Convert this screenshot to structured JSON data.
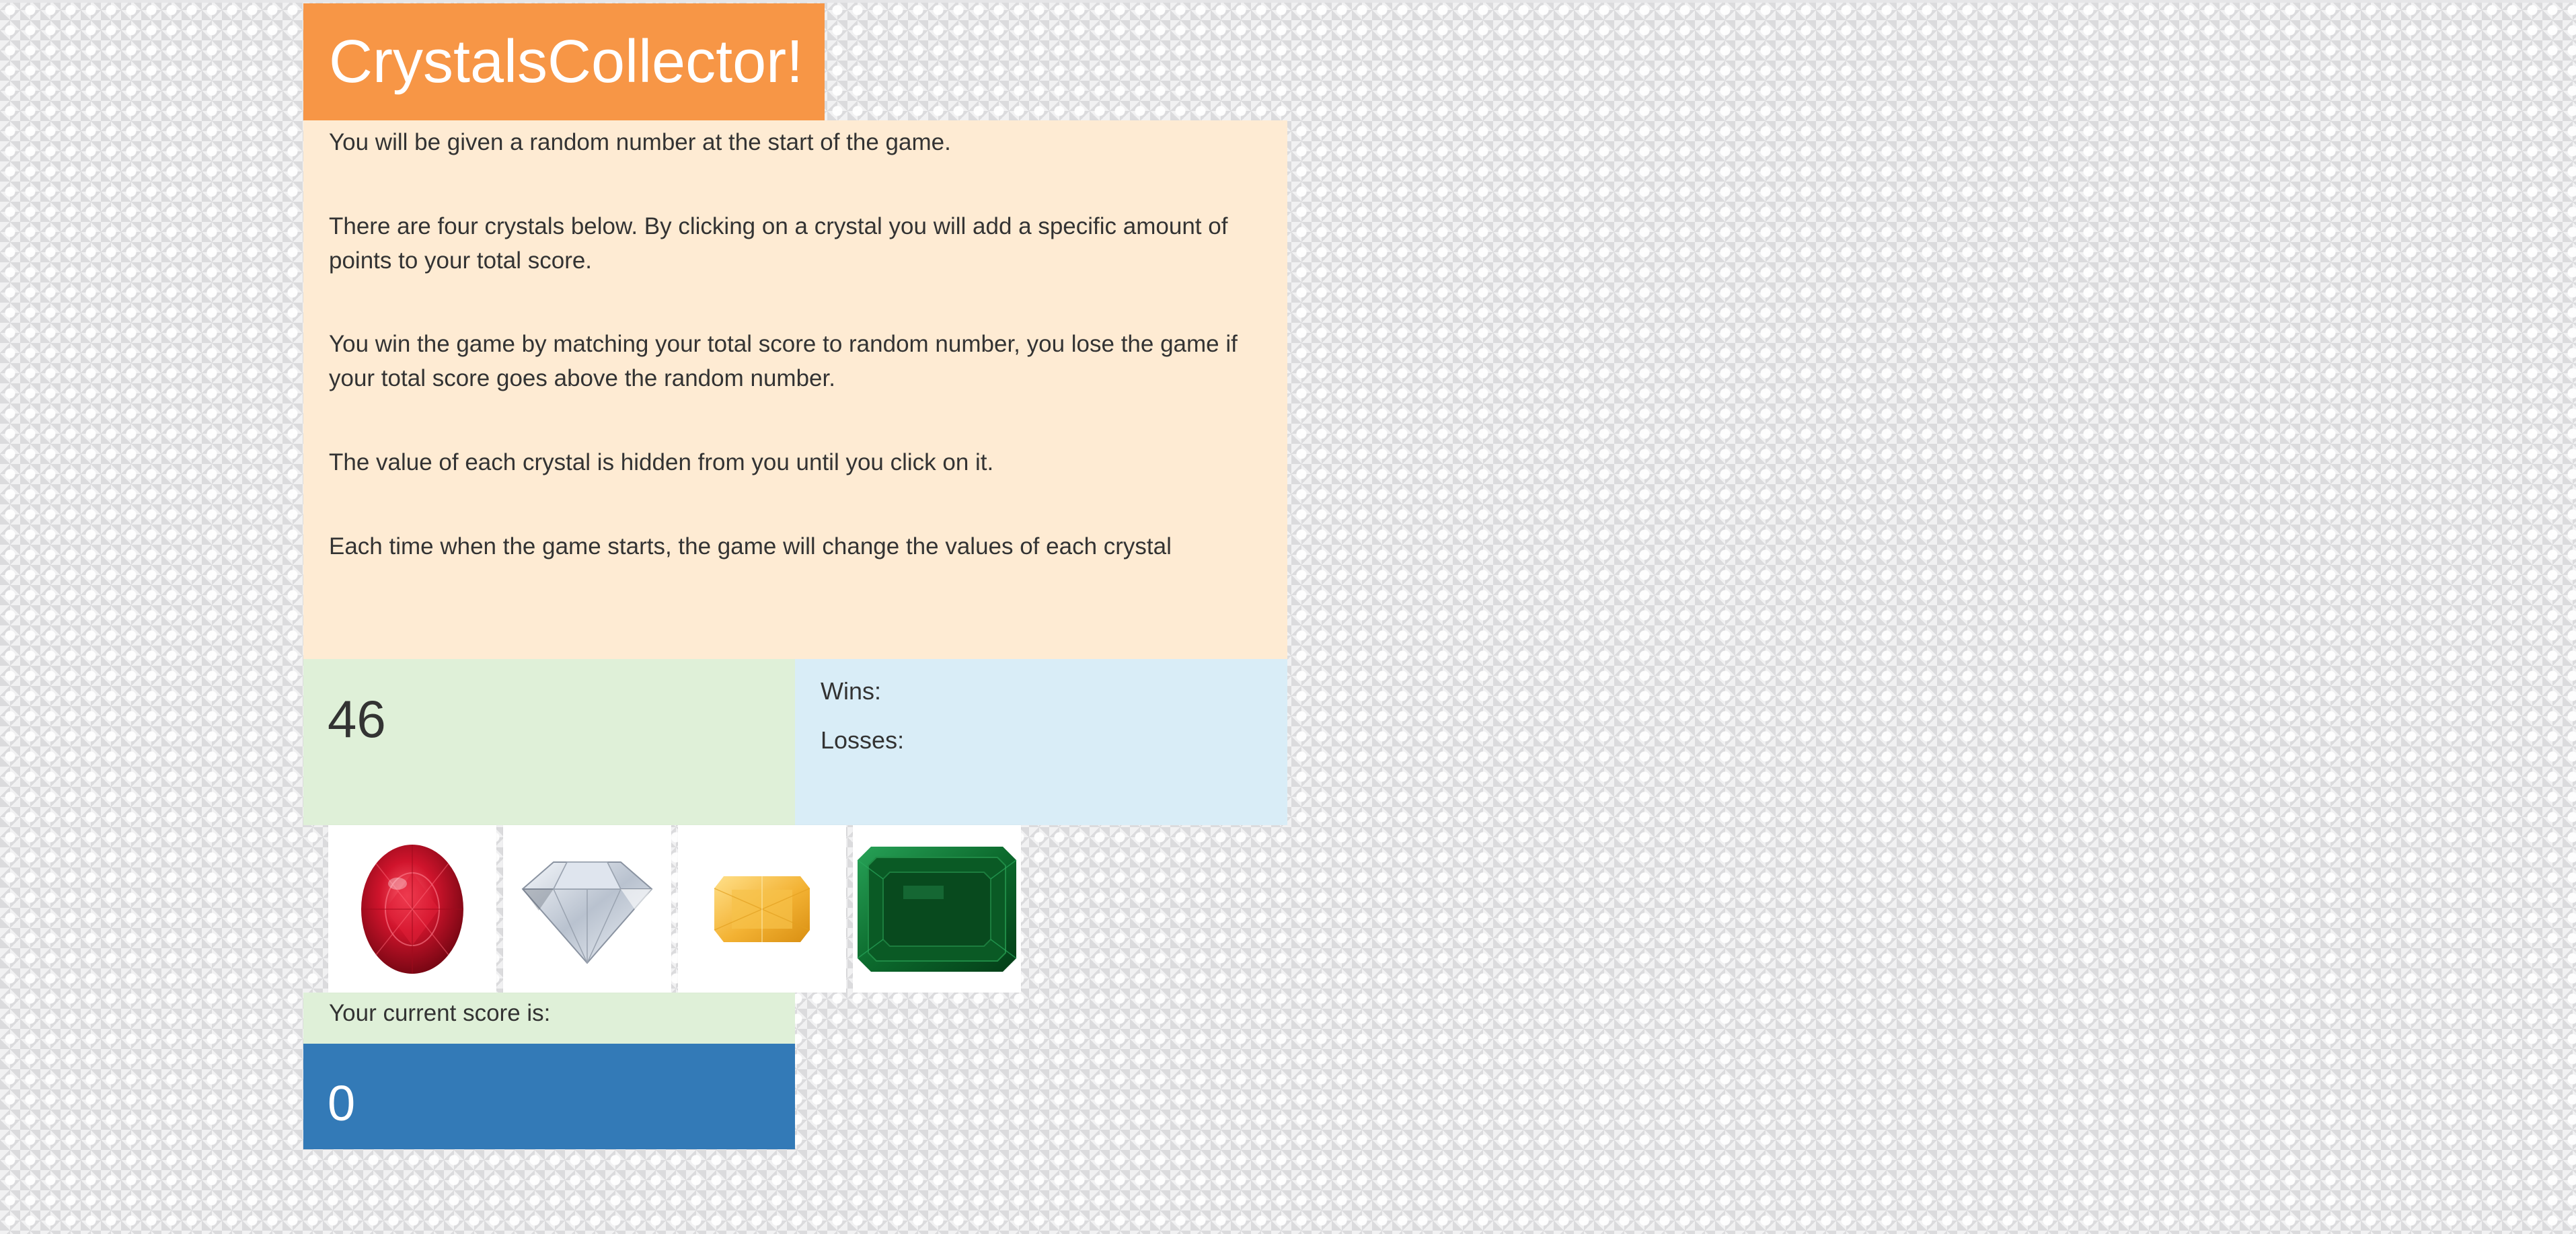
{
  "game": {
    "title": "CrystalsCollector!",
    "instructions": [
      "You will be given a random number at the start of the game.",
      "There are four crystals below. By clicking on a crystal you will add a specific amount of points to your total score.",
      "You win the game by matching your total score to random number, you lose the game if your total score goes above the random number.",
      "The value of each crystal is hidden from you until you click on it.",
      "Each time when the game starts, the game will change the values of each crystal"
    ],
    "target_number": "46",
    "record": {
      "wins_label": "Wins:",
      "losses_label": "Losses:"
    },
    "crystals": [
      {
        "icon": "ruby-icon",
        "color": "#c4122a"
      },
      {
        "icon": "diamond-icon",
        "color": "#d8dee8"
      },
      {
        "icon": "topaz-icon",
        "color": "#f4b73a"
      },
      {
        "icon": "emerald-icon",
        "color": "#0b6b2c"
      }
    ],
    "score_label": "Your current score is:",
    "current_score": "0"
  },
  "colors": {
    "title_bg": "#f79646",
    "instructions_bg": "#feebd3",
    "target_bg": "#dff0d8",
    "record_bg": "#d9edf7",
    "score_bg": "#337ab7"
  }
}
